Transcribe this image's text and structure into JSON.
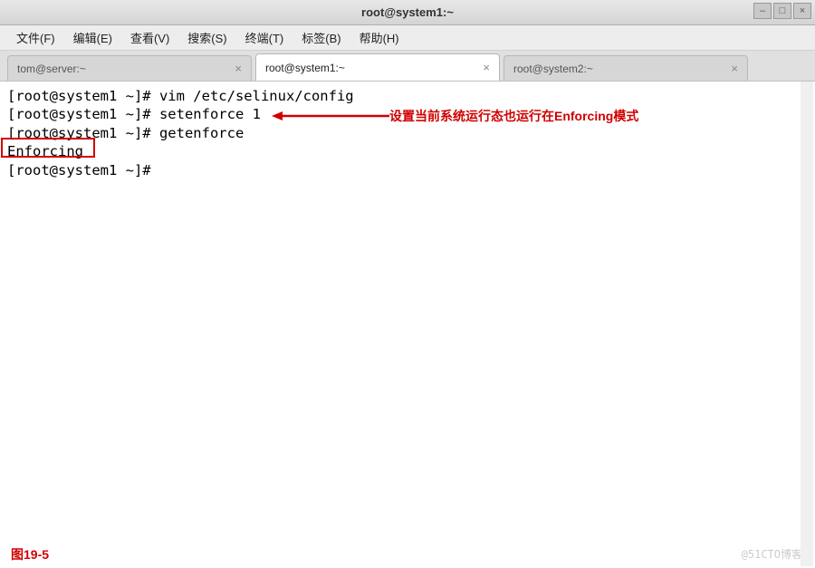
{
  "titlebar": {
    "title": "root@system1:~"
  },
  "window_controls": {
    "minimize": "–",
    "maximize": "□",
    "close": "×"
  },
  "menubar": {
    "items": [
      "文件(F)",
      "编辑(E)",
      "查看(V)",
      "搜索(S)",
      "终端(T)",
      "标签(B)",
      "帮助(H)"
    ]
  },
  "tabs": {
    "list": [
      {
        "label": "tom@server:~",
        "active": false
      },
      {
        "label": "root@system1:~",
        "active": true
      },
      {
        "label": "root@system2:~",
        "active": false
      }
    ],
    "close_glyph": "×"
  },
  "terminal": {
    "lines": [
      "[root@system1 ~]# vim /etc/selinux/config",
      "[root@system1 ~]# setenforce 1",
      "[root@system1 ~]# getenforce",
      "Enforcing",
      "[root@system1 ~]# "
    ]
  },
  "annotations": {
    "arrow_text": "设置当前系统运行态也运行在Enforcing模式",
    "caption": "图19-5"
  },
  "watermark": "@51CTO博客"
}
